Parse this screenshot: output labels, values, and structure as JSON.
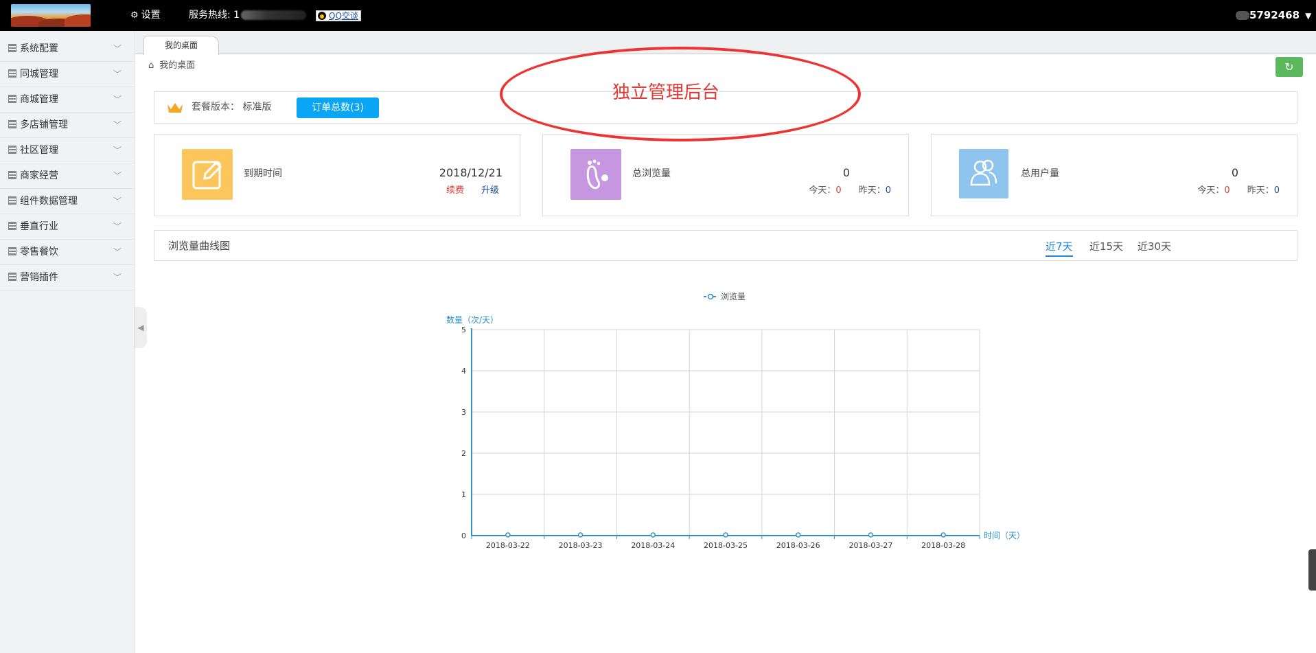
{
  "topbar": {
    "settings_label": "设置",
    "hotline_label": "服务热线: 1",
    "qq_label": "QQ交谈",
    "user_id": "5792468",
    "caret": "▼"
  },
  "sidebar": {
    "items": [
      {
        "label": "系统配置"
      },
      {
        "label": "同城管理"
      },
      {
        "label": "商城管理"
      },
      {
        "label": "多店铺管理"
      },
      {
        "label": "社区管理"
      },
      {
        "label": "商家经营"
      },
      {
        "label": "组件数据管理"
      },
      {
        "label": "垂直行业"
      },
      {
        "label": "零售餐饮"
      },
      {
        "label": "营销插件"
      }
    ]
  },
  "tabs": [
    {
      "label": "我的桌面"
    }
  ],
  "breadcrumb": {
    "label": "我的桌面"
  },
  "package": {
    "label": "套餐版本： 标准版",
    "order_button": "订单总数(3)"
  },
  "cards": {
    "expiry": {
      "title": "到期时间",
      "date": "2018/12/21",
      "renew": "续费",
      "upgrade": "升级",
      "color": "#fcc65d"
    },
    "views": {
      "title": "总浏览量",
      "total": "0",
      "today_label": "今天：",
      "today_value": "0",
      "yesterday_label": "昨天：",
      "yesterday_value": "0",
      "color": "#c696e0"
    },
    "users": {
      "title": "总用户量",
      "total": "0",
      "today_label": "今天：",
      "today_value": "0",
      "yesterday_label": "昨天：",
      "yesterday_value": "0",
      "color": "#8fc4ef"
    }
  },
  "chart_section": {
    "title": "浏览量曲线图",
    "ranges": [
      {
        "label": "近7天",
        "active": true
      },
      {
        "label": "近15天",
        "active": false
      },
      {
        "label": "近30天",
        "active": false
      }
    ]
  },
  "annotation": {
    "text": "独立管理后台"
  },
  "chart_data": {
    "type": "line",
    "series": [
      {
        "name": "浏览量",
        "values": [
          0,
          0,
          0,
          0,
          0,
          0,
          0
        ]
      }
    ],
    "categories": [
      "2018-03-22",
      "2018-03-23",
      "2018-03-24",
      "2018-03-25",
      "2018-03-26",
      "2018-03-27",
      "2018-03-28"
    ],
    "y_ticks": [
      "0",
      "1",
      "2",
      "3",
      "4",
      "5"
    ],
    "ylim": [
      0,
      5
    ],
    "xlabel": "时间（天）",
    "ylabel": "数量（次/天）",
    "legend": "top-center",
    "grid": true,
    "line_color": "#2f8fc6"
  }
}
